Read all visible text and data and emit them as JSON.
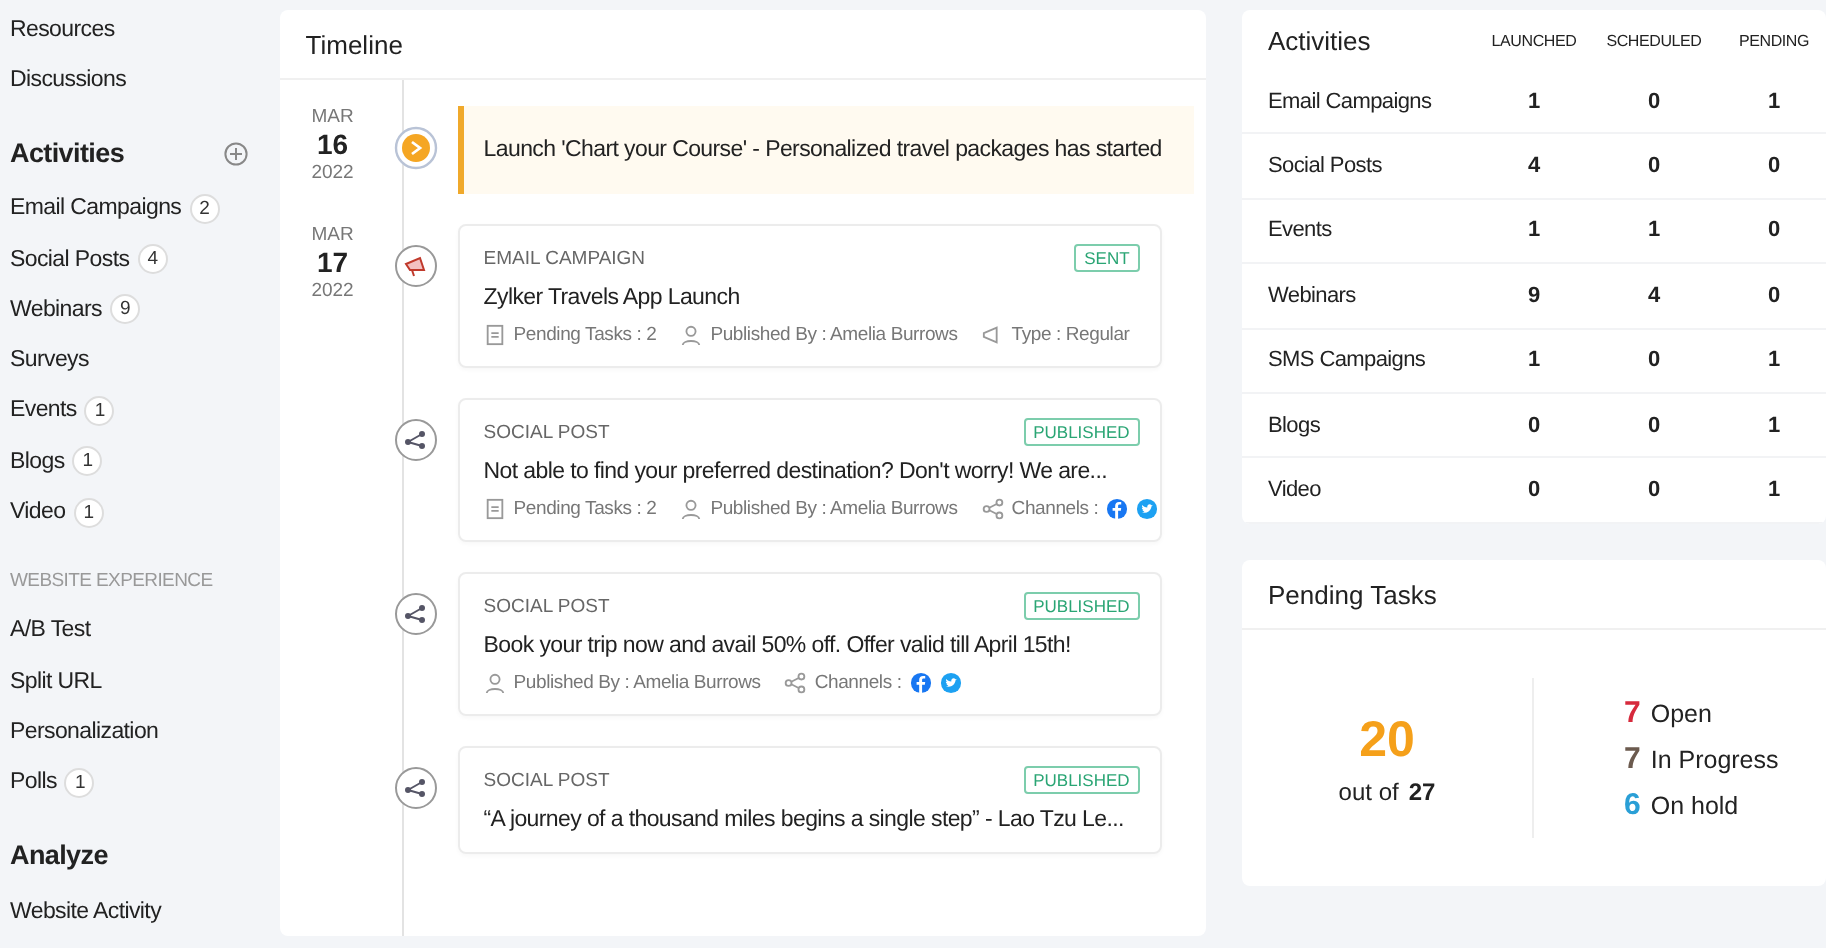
{
  "sidebar": {
    "top_items": [
      "Resources",
      "Discussions"
    ],
    "sections": [
      {
        "kind": "heading",
        "title": "Activities",
        "add": true,
        "items": [
          {
            "label": "Email Campaigns",
            "count": "2"
          },
          {
            "label": "Social Posts",
            "count": "4"
          },
          {
            "label": "Webinars",
            "count": "9"
          },
          {
            "label": "Surveys"
          },
          {
            "label": "Events",
            "count": "1"
          },
          {
            "label": "Blogs",
            "count": "1"
          },
          {
            "label": "Video",
            "count": "1"
          }
        ]
      },
      {
        "kind": "caption",
        "title": "WEBSITE EXPERIENCE",
        "items": [
          {
            "label": "A/B Test"
          },
          {
            "label": "Split URL"
          },
          {
            "label": "Personalization"
          },
          {
            "label": "Polls",
            "count": "1"
          }
        ]
      },
      {
        "kind": "heading",
        "title": "Analyze",
        "items": [
          {
            "label": "Website Activity"
          }
        ]
      }
    ]
  },
  "timeline": {
    "title": "Timeline",
    "entries": [
      {
        "date": {
          "month": "MAR",
          "day": "16",
          "year": "2022"
        },
        "kind": "launch",
        "text": "Launch 'Chart your Course' - Personalized travel packages has started"
      },
      {
        "date": {
          "month": "MAR",
          "day": "17",
          "year": "2022"
        },
        "kind": "email",
        "type": "EMAIL CAMPAIGN",
        "status": "SENT",
        "title": "Zylker Travels App Launch",
        "meta": [
          {
            "kind": "tasks",
            "text": "Pending Tasks : 2"
          },
          {
            "kind": "user",
            "text": "Published By : Amelia Burrows"
          },
          {
            "kind": "type",
            "text": "Type :  Regular"
          }
        ]
      },
      {
        "kind": "social",
        "type": "SOCIAL POST",
        "status": "PUBLISHED",
        "title": "Not able to find your preferred destination? Don't worry! We are...",
        "meta": [
          {
            "kind": "tasks",
            "text": "Pending Tasks : 2"
          },
          {
            "kind": "user",
            "text": "Published By : Amelia Burrows"
          },
          {
            "kind": "channels",
            "text": "Channels :"
          }
        ]
      },
      {
        "kind": "social",
        "type": "SOCIAL POST",
        "status": "PUBLISHED",
        "title": "Book your trip now and avail 50% off. Offer valid till April 15th!",
        "meta": [
          {
            "kind": "user",
            "text": "Published By : Amelia Burrows"
          },
          {
            "kind": "channels",
            "text": "Channels :"
          }
        ]
      },
      {
        "kind": "social",
        "type": "SOCIAL POST",
        "status": "PUBLISHED",
        "title": "“A journey of a thousand miles begins a single step” - Lao Tzu Le..."
      }
    ]
  },
  "activities": {
    "title": "Activities",
    "columns": [
      "LAUNCHED",
      "SCHEDULED",
      "PENDING"
    ],
    "rows": [
      {
        "name": "Email Campaigns",
        "values": [
          "1",
          "0",
          "1"
        ]
      },
      {
        "name": "Social Posts",
        "values": [
          "4",
          "0",
          "0"
        ]
      },
      {
        "name": "Events",
        "values": [
          "1",
          "1",
          "0"
        ]
      },
      {
        "name": "Webinars",
        "values": [
          "9",
          "4",
          "0"
        ]
      },
      {
        "name": "SMS Campaigns",
        "values": [
          "1",
          "0",
          "1"
        ]
      },
      {
        "name": "Blogs",
        "values": [
          "0",
          "0",
          "1"
        ]
      },
      {
        "name": "Video",
        "values": [
          "0",
          "0",
          "1"
        ]
      }
    ]
  },
  "pending_tasks": {
    "title": "Pending Tasks",
    "count": "20",
    "label": "out of",
    "total": "27",
    "statuses": [
      {
        "count": "7",
        "label": "Open",
        "color": "#d62a3c"
      },
      {
        "count": "7",
        "label": "In Progress",
        "color": "#6b5a4e"
      },
      {
        "count": "6",
        "label": "On hold",
        "color": "#2a9fd6"
      }
    ]
  }
}
